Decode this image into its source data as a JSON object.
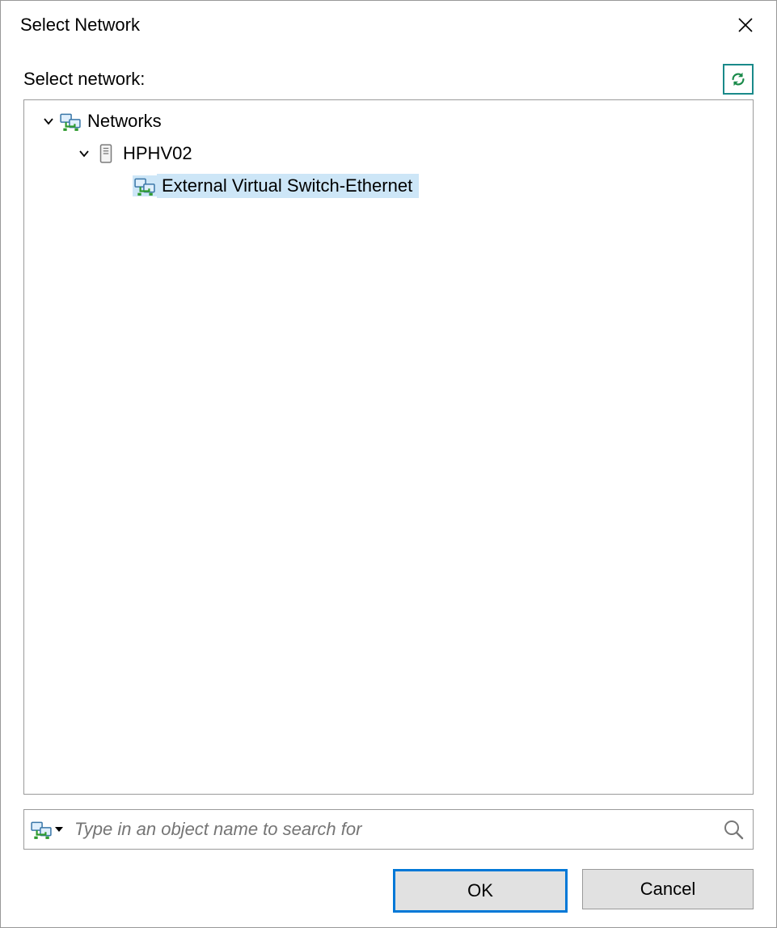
{
  "window": {
    "title": "Select Network"
  },
  "label": "Select network:",
  "tree": {
    "root": {
      "label": "Networks",
      "children": [
        {
          "label": "HPHV02",
          "children": [
            {
              "label": "External Virtual Switch-Ethernet"
            }
          ]
        }
      ]
    }
  },
  "search": {
    "placeholder": "Type in an object name to search for"
  },
  "buttons": {
    "ok": "OK",
    "cancel": "Cancel"
  }
}
